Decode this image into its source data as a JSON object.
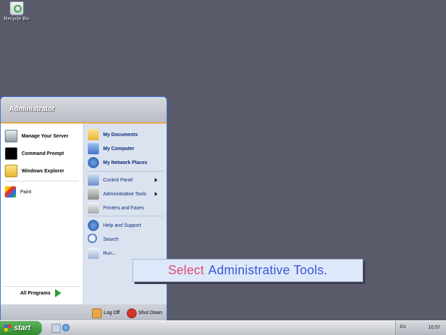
{
  "desktop": {
    "recycle_bin_label": "Recycle Bin"
  },
  "start_menu": {
    "user_name": "Administrator",
    "left_items": [
      {
        "label": "Manage Your Server",
        "icon": "server-icon"
      },
      {
        "label": "Command Prompt",
        "icon": "command-prompt-icon"
      },
      {
        "label": "Windows Explorer",
        "icon": "folder-explorer-icon"
      },
      {
        "label": "Paint",
        "icon": "paint-icon"
      }
    ],
    "all_programs_label": "All Programs",
    "right_items": [
      {
        "label": "My Documents",
        "icon": "documents-folder-icon"
      },
      {
        "label": "My Computer",
        "icon": "computer-icon"
      },
      {
        "label": "My Network Places",
        "icon": "network-places-icon"
      },
      {
        "label": "Control Panel",
        "icon": "control-panel-icon"
      },
      {
        "label": "Administrative Tools",
        "icon": "administrative-tools-icon"
      },
      {
        "label": "Printers and Faxes",
        "icon": "printer-icon"
      },
      {
        "label": "Help and Support",
        "icon": "help-icon"
      },
      {
        "label": "Search",
        "icon": "search-icon"
      },
      {
        "label": "Run...",
        "icon": "run-icon"
      }
    ],
    "log_off_label": "Log Off",
    "shut_down_label": "Shut Down"
  },
  "hint": {
    "verb": "Select",
    "object": "Administrative Tools."
  },
  "taskbar": {
    "start_label": "start",
    "language": "EN",
    "clock": "10:57"
  },
  "colors": {
    "desktop": "#5a5b6a",
    "start_button": "#3c9a3c",
    "menu_right_panel": "#dbe3f0",
    "menu_accent": "#e8a54b"
  }
}
